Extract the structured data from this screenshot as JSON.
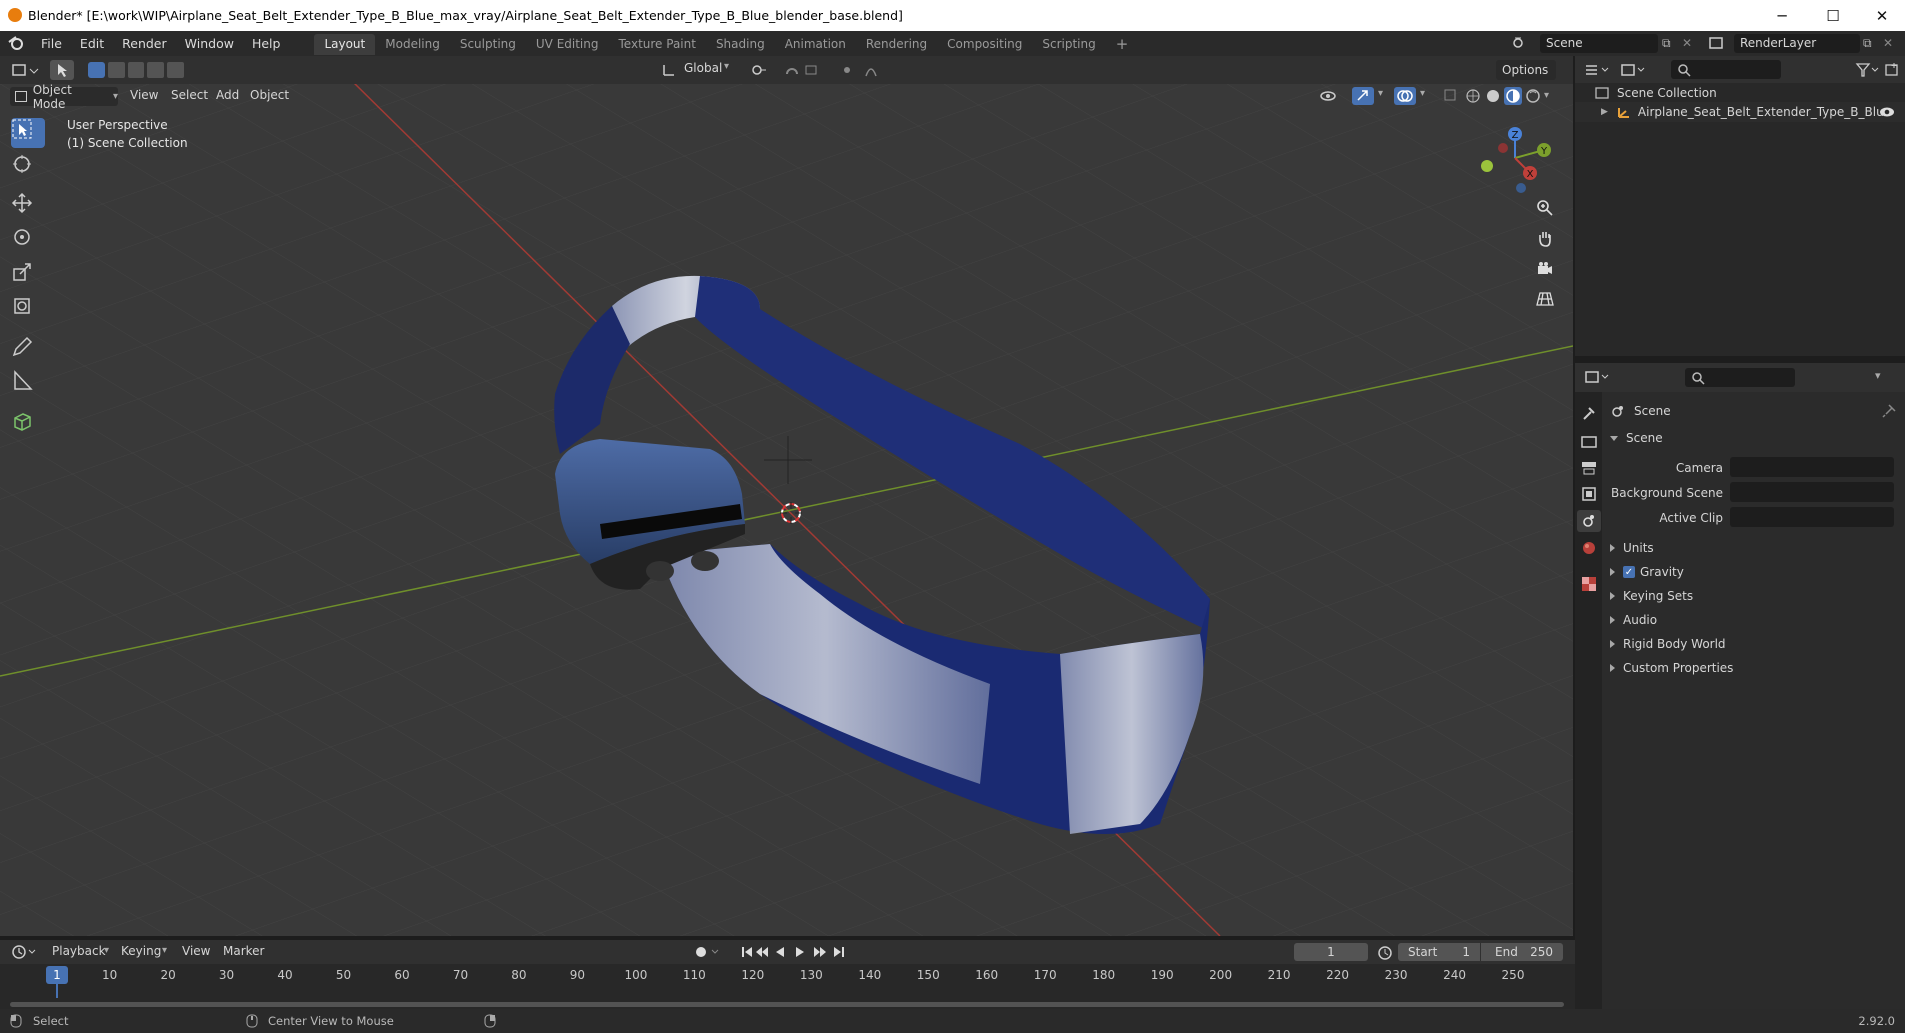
{
  "window": {
    "title": "Blender* [E:\\work\\WIP\\Airplane_Seat_Belt_Extender_Type_B_Blue_max_vray/Airplane_Seat_Belt_Extender_Type_B_Blue_blender_base.blend]",
    "minimize": "─",
    "maximize": "☐",
    "close": "✕"
  },
  "menu": [
    "File",
    "Edit",
    "Render",
    "Window",
    "Help"
  ],
  "workspaces": [
    "Layout",
    "Modeling",
    "Sculpting",
    "UV Editing",
    "Texture Paint",
    "Shading",
    "Animation",
    "Rendering",
    "Compositing",
    "Scripting"
  ],
  "workspace_add": "+",
  "scene_selector": "Scene",
  "view_layer": "RenderLayer",
  "viewport_header": {
    "mode": "Object Mode",
    "menus": [
      "View",
      "Select",
      "Add",
      "Object"
    ],
    "transform_orientation": "Global",
    "options": "Options"
  },
  "viewport_overlay_text": {
    "perspective": "User Perspective",
    "collection": "(1) Scene Collection"
  },
  "gizmo_axes": {
    "x": "X",
    "y": "Y",
    "z": "Z"
  },
  "outliner": {
    "root": "Scene Collection",
    "items": [
      "Airplane_Seat_Belt_Extender_Type_B_Blue"
    ]
  },
  "properties": {
    "header": "Scene",
    "panel_title": "Scene",
    "fields": [
      {
        "label": "Camera",
        "value": ""
      },
      {
        "label": "Background Scene",
        "value": ""
      },
      {
        "label": "Active Clip",
        "value": ""
      }
    ],
    "sections": [
      "Units",
      "Gravity",
      "Keying Sets",
      "Audio",
      "Rigid Body World",
      "Custom Properties"
    ],
    "gravity_checked": true
  },
  "timeline": {
    "menus": [
      "Playback",
      "Keying",
      "View",
      "Marker"
    ],
    "current_frame": "1",
    "start_label": "Start",
    "start": "1",
    "end_label": "End",
    "end": "250",
    "ticks": [
      "1",
      "10",
      "20",
      "30",
      "40",
      "50",
      "60",
      "70",
      "80",
      "90",
      "100",
      "110",
      "120",
      "130",
      "140",
      "150",
      "160",
      "170",
      "180",
      "190",
      "200",
      "210",
      "220",
      "230",
      "240",
      "250"
    ]
  },
  "statusbar": {
    "left_action": "Select",
    "middle_action": "Center View to Mouse",
    "version": "2.92.0"
  },
  "colors": {
    "accent": "#4772b3",
    "x_axis": "#b8403a",
    "y_axis": "#7ca02c",
    "belt": "#1d2f7a"
  }
}
